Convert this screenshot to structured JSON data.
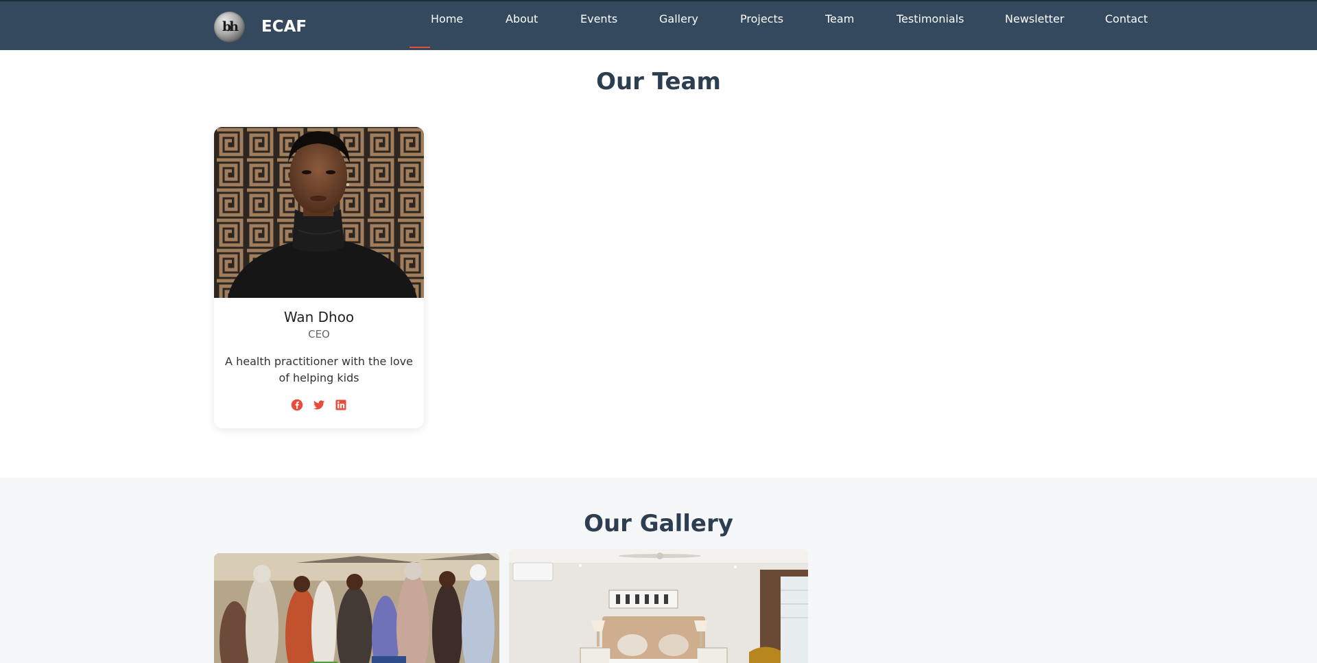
{
  "brand": {
    "logo_text": "bh",
    "name": "ECAF"
  },
  "nav": {
    "items": [
      {
        "label": "Home",
        "active": true
      },
      {
        "label": "About"
      },
      {
        "label": "Events"
      },
      {
        "label": "Gallery"
      },
      {
        "label": "Projects"
      },
      {
        "label": "Team"
      },
      {
        "label": "Testimonials"
      },
      {
        "label": "Newsletter"
      },
      {
        "label": "Contact"
      }
    ]
  },
  "team": {
    "title": "Our Team",
    "members": [
      {
        "name": "Wan Dhoo",
        "role": "CEO",
        "bio": "A health practitioner with the love of helping kids",
        "socials": [
          "facebook-icon",
          "twitter-icon",
          "linkedin-icon"
        ]
      }
    ]
  },
  "gallery": {
    "title": "Our Gallery"
  },
  "colors": {
    "navbar": "#34495e",
    "accent": "#e74c3c",
    "heading": "#2c3e50",
    "gallery_bg": "#f6f7f9"
  }
}
